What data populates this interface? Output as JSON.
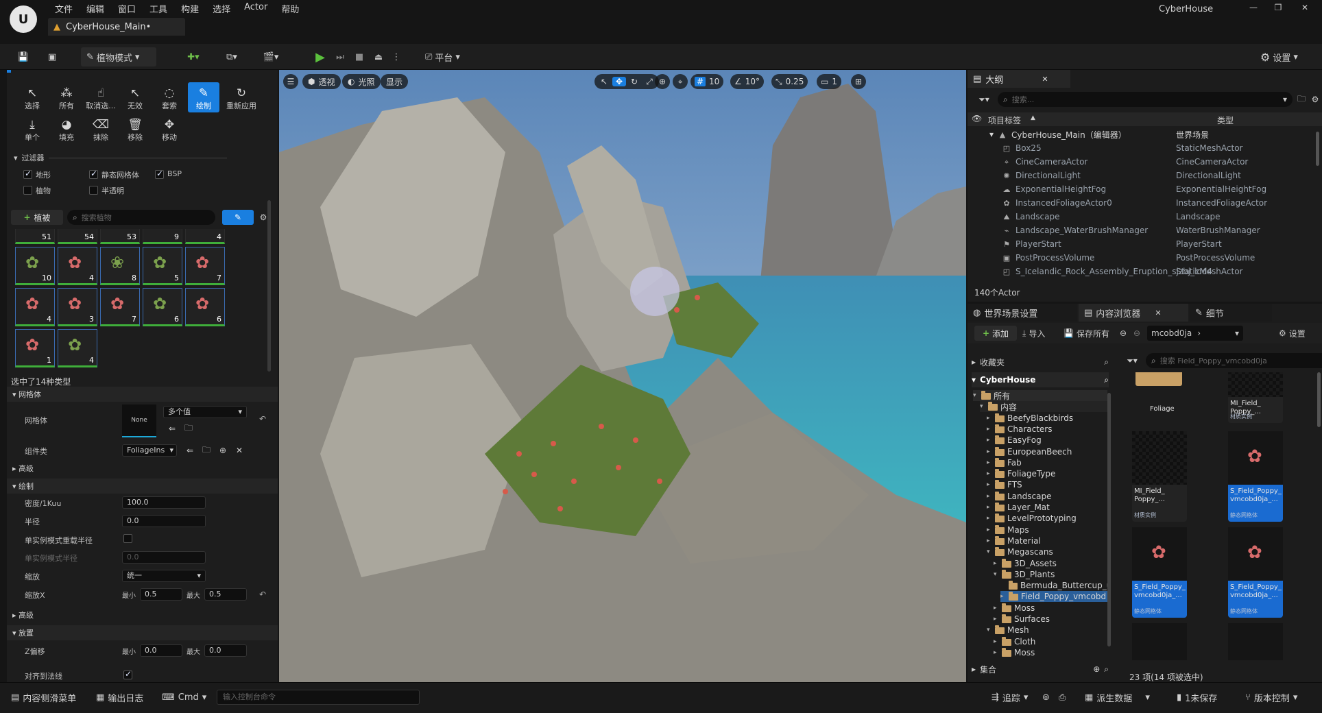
{
  "window": {
    "project_name": "CyberHouse"
  },
  "menu": [
    "文件",
    "编辑",
    "窗口",
    "工具",
    "构建",
    "选择",
    "Actor",
    "帮助"
  ],
  "level_tab": {
    "label": "CyberHouse_Main•"
  },
  "toolbar": {
    "mode_label": "植物模式",
    "platform_label": "平台",
    "settings_label": "设置"
  },
  "foliage_tools": {
    "row1": [
      "选择",
      "所有",
      "取消选...",
      "无效",
      "套索",
      "绘制",
      "重新应用"
    ],
    "row2": [
      "单个",
      "填充",
      "抹除",
      "移除",
      "移动"
    ],
    "active": "绘制"
  },
  "filters": {
    "title": "过滤器",
    "items": [
      {
        "label": "地形",
        "checked": true
      },
      {
        "label": "静态网格体",
        "checked": true
      },
      {
        "label": "BSP",
        "checked": true
      },
      {
        "label": "植物",
        "checked": false
      },
      {
        "label": "半透明",
        "checked": false
      }
    ]
  },
  "foliage_palette": {
    "add_label": "植被",
    "search_placeholder": "搜索植物",
    "row0_counts": [
      "51",
      "54",
      "53",
      "9",
      "4"
    ],
    "row1_counts": [
      "10",
      "4",
      "8",
      "5",
      "7"
    ],
    "row2_counts": [
      "4",
      "3",
      "7",
      "6",
      "6"
    ],
    "row3_counts": [
      "1",
      "4"
    ],
    "selection_text": "选中了14种类型"
  },
  "details": {
    "mesh_section": "网格体",
    "mesh_label": "网格体",
    "mesh_thumb": "None",
    "mesh_value": "多个值",
    "component_label": "组件类",
    "component_value": "FoliageIns",
    "advanced1": "高级",
    "paint_section": "绘制",
    "density_label": "密度/1Kuu",
    "density_value": "100.0",
    "radius_label": "半径",
    "radius_value": "0.0",
    "single_instance_label": "单实例模式重载半径",
    "single_instance_radius_label": "单实例模式半径",
    "single_instance_radius_value": "0.0",
    "scaling_label": "缩放",
    "scaling_value": "统一",
    "scalex_label": "缩放X",
    "min_label": "最小",
    "max_label": "最大",
    "scalex_min": "0.5",
    "scalex_max": "0.5",
    "advanced2": "高级",
    "placement_section": "放置",
    "zoffset_label": "Z偏移",
    "zoffset_min": "0.0",
    "zoffset_max": "0.0",
    "align_normal_label": "对齐到法线"
  },
  "viewport": {
    "perspective": "透视",
    "lit": "光照",
    "show": "显示",
    "grid_snap": "10",
    "angle_snap": "10°",
    "scale_snap": "0.25",
    "camera_speed": "1"
  },
  "outliner": {
    "title": "大纲",
    "search_placeholder": "搜索...",
    "col_label": "项目标签",
    "col_type": "类型",
    "rows": [
      {
        "name": "CyberHouse_Main（编辑器）",
        "type": "世界场景"
      },
      {
        "name": "Box25",
        "type": "StaticMeshActor"
      },
      {
        "name": "CineCameraActor",
        "type": "CineCameraActor"
      },
      {
        "name": "DirectionalLight",
        "type": "DirectionalLight"
      },
      {
        "name": "ExponentialHeightFog",
        "type": "ExponentialHeightFog"
      },
      {
        "name": "InstancedFoliageActor0",
        "type": "InstancedFoliageActor"
      },
      {
        "name": "Landscape",
        "type": "Landscape"
      },
      {
        "name": "Landscape_WaterBrushManager",
        "type": "WaterBrushManager"
      },
      {
        "name": "PlayerStart",
        "type": "PlayerStart"
      },
      {
        "name": "PostProcessVolume",
        "type": "PostProcessVolume"
      },
      {
        "name": "S_Icelandic_Rock_Assembly_Eruption_sjzbj_lod4",
        "type": "StaticMeshActor"
      }
    ],
    "actor_count": "140个Actor"
  },
  "content_browser": {
    "tabs": [
      "世界场景设置",
      "内容浏览器",
      "细节"
    ],
    "add_label": "添加",
    "import_label": "导入",
    "save_all_label": "保存所有",
    "path_label": "mcobd0ja",
    "settings_label": "设置",
    "favorites_label": "收藏夹",
    "project_label": "CyberHouse",
    "search_placeholder": "搜索 Field_Poppy_vmcobd0ja",
    "tree": [
      {
        "label": "所有",
        "level": 0,
        "open": true
      },
      {
        "label": "内容",
        "level": 1,
        "open": true
      },
      {
        "label": "BeefyBlackbirds",
        "level": 2
      },
      {
        "label": "Characters",
        "level": 2
      },
      {
        "label": "EasyFog",
        "level": 2
      },
      {
        "label": "EuropeanBeech",
        "level": 2
      },
      {
        "label": "Fab",
        "level": 2
      },
      {
        "label": "FoliageType",
        "level": 2
      },
      {
        "label": "FTS",
        "level": 2
      },
      {
        "label": "Landscape",
        "level": 2
      },
      {
        "label": "Layer_Mat",
        "level": 2
      },
      {
        "label": "LevelPrototyping",
        "level": 2
      },
      {
        "label": "Maps",
        "level": 2
      },
      {
        "label": "Material",
        "level": 2
      },
      {
        "label": "Megascans",
        "level": 2,
        "open": true
      },
      {
        "label": "3D_Assets",
        "level": 3
      },
      {
        "label": "3D_Plants",
        "level": 3,
        "open": true
      },
      {
        "label": "Bermuda_Buttercup_u",
        "level": 4
      },
      {
        "label": "Field_Poppy_vmcobd",
        "level": 4,
        "selected": true
      },
      {
        "label": "Moss",
        "level": 3
      },
      {
        "label": "Surfaces",
        "level": 3
      },
      {
        "label": "Mesh",
        "level": 2,
        "open": true
      },
      {
        "label": "Cloth",
        "level": 3
      },
      {
        "label": "Moss",
        "level": 3
      }
    ],
    "collections_label": "集合",
    "assets": [
      {
        "name": "Foliage",
        "type": ""
      },
      {
        "name": "MI_Field_ Poppy_...",
        "type": "材质实例"
      },
      {
        "name": "MI_Field_ Poppy_...",
        "type": "材质实例"
      },
      {
        "name": "S_Field_Poppy_ vmcobd0ja_...",
        "type": "静态网格体"
      },
      {
        "name": "S_Field_Poppy_ vmcobd0ja_...",
        "type": "静态网格体"
      },
      {
        "name": "S_Field_Poppy_ vmcobd0ja_...",
        "type": "静态网格体"
      }
    ],
    "item_count": "23 项(14 项被选中)"
  },
  "statusbar": {
    "content_drawer": "内容侧滑菜单",
    "output_log": "输出日志",
    "cmd": "Cmd",
    "console_placeholder": "输入控制台命令",
    "trace": "追踪",
    "derived_data": "派生数据",
    "unsaved": "1未保存",
    "source_control": "版本控制"
  }
}
